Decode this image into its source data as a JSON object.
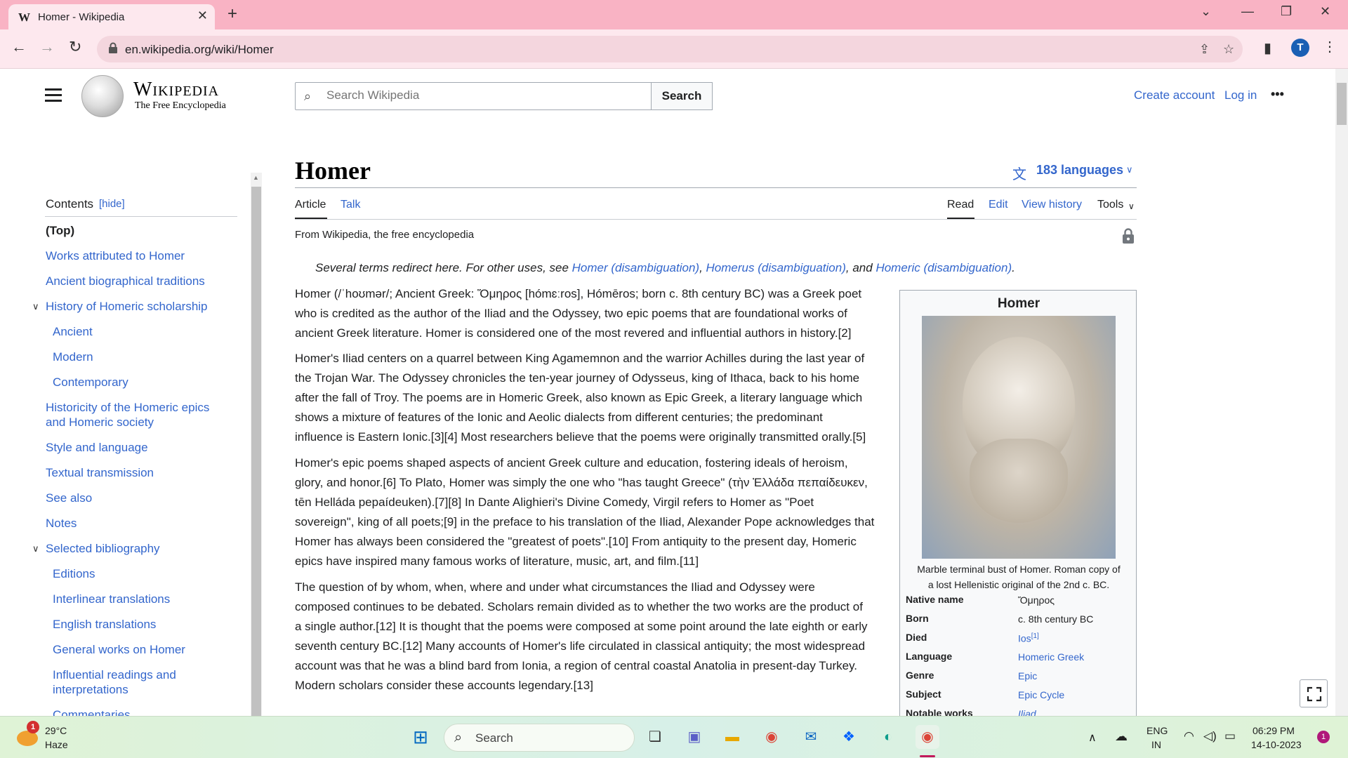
{
  "browser": {
    "tab_title": "Homer - Wikipedia",
    "favicon": "W",
    "new_tab": "+",
    "url": "en.wikipedia.org/wiki/Homer",
    "profile_initial": "T"
  },
  "wiki": {
    "wordmark": "Wikipedia",
    "tagline": "The Free Encyclopedia",
    "search_placeholder": "Search Wikipedia",
    "search_button": "Search",
    "create_account": "Create account",
    "log_in": "Log in",
    "more": "•••"
  },
  "toc": {
    "heading": "Contents",
    "hide": "[hide]",
    "items": [
      {
        "label": "(Top)"
      },
      {
        "label": "Works attributed to Homer"
      },
      {
        "label": "Ancient biographical traditions"
      },
      {
        "label": "History of Homeric scholarship"
      },
      {
        "label": "Ancient"
      },
      {
        "label": "Modern"
      },
      {
        "label": "Contemporary"
      },
      {
        "label": "Historicity of the Homeric epics"
      },
      {
        "label": "and Homeric society"
      },
      {
        "label": "Style and language"
      },
      {
        "label": "Textual transmission"
      },
      {
        "label": "See also"
      },
      {
        "label": "Notes"
      },
      {
        "label": "Selected bibliography"
      },
      {
        "label": "Editions"
      },
      {
        "label": "Interlinear translations"
      },
      {
        "label": "English translations"
      },
      {
        "label": "General works on Homer"
      },
      {
        "label": "Influential readings and"
      },
      {
        "label": "interpretations"
      },
      {
        "label": "Commentaries"
      }
    ]
  },
  "article": {
    "title": "Homer",
    "languages": "183 languages",
    "tab_article": "Article",
    "tab_talk": "Talk",
    "tab_read": "Read",
    "tab_edit": "Edit",
    "tab_history": "View history",
    "tab_tools": "Tools",
    "from": "From Wikipedia, the free encyclopedia",
    "hatnote": {
      "prefix": "Several terms redirect here. For other uses, see ",
      "l1": "Homer (disambiguation)",
      "sep1": ", ",
      "l2": "Homerus (disambiguation)",
      "sep2": ", and ",
      "l3": "Homeric (disambiguation)",
      "end": "."
    },
    "p1": [
      "Homer (/ˈhoʊmər/; Ancient Greek: Ὅμηρος [hómɛːros], Hómēros; born c. 8th century BC) was a Greek poet",
      "who is credited as the author of the Iliad and the Odyssey, two epic poems that are foundational works of",
      "ancient Greek literature. Homer is considered one of the most revered and influential authors in history.[2]"
    ],
    "p2": [
      "Homer's Iliad centers on a quarrel between King Agamemnon and the warrior Achilles during the last year of",
      "the Trojan War. The Odyssey chronicles the ten-year journey of Odysseus, king of Ithaca, back to his home",
      "after the fall of Troy. The poems are in Homeric Greek, also known as Epic Greek, a literary language which",
      "shows a mixture of features of the Ionic and Aeolic dialects from different centuries; the predominant",
      "influence is Eastern Ionic.[3][4] Most researchers believe that the poems were originally transmitted orally.[5]"
    ],
    "p3": [
      "Homer's epic poems shaped aspects of ancient Greek culture and education, fostering ideals of heroism,",
      "glory, and honor.[6] To Plato, Homer was simply the one who \"has taught Greece\" (τὴν Ἑλλάδα πεπαίδευκεν,",
      "tēn Helláda pepaídeuken).[7][8] In Dante Alighieri's Divine Comedy, Virgil refers to Homer as \"Poet",
      "sovereign\", king of all poets;[9] in the preface to his translation of the Iliad, Alexander Pope acknowledges that",
      "Homer has always been considered the \"greatest of poets\".[10] From antiquity to the present day, Homeric",
      "epics have inspired many famous works of literature, music, art, and film.[11]"
    ],
    "p4": [
      "The question of by whom, when, where and under what circumstances the Iliad and Odyssey were",
      "composed continues to be debated. Scholars remain divided as to whether the two works are the product of",
      "a single author.[12] It is thought that the poems were composed at some point around the late eighth or early",
      "seventh century BC.[12] Many accounts of Homer's life circulated in classical antiquity; the most widespread",
      "account was that he was a blind bard from Ionia, a region of central coastal Anatolia in present-day Turkey.",
      "Modern scholars consider these accounts legendary.[13]"
    ]
  },
  "infobox": {
    "title": "Homer",
    "caption_1": "Marble terminal bust of Homer. Roman copy of",
    "caption_2": "a lost Hellenistic original of the 2nd c. BC.",
    "rows": [
      {
        "label": "Native name",
        "value": "Ὅμηρος"
      },
      {
        "label": "Born",
        "value": "c. 8th century BC"
      },
      {
        "label": "Died",
        "value": "Ios",
        "ref": "[1]"
      },
      {
        "label": "Language",
        "value": "Homeric Greek"
      },
      {
        "label": "Genre",
        "value": "Epic"
      },
      {
        "label": "Subject",
        "value": "Epic Cycle"
      },
      {
        "label": "Notable works",
        "value": "Iliad"
      }
    ]
  },
  "taskbar": {
    "weather_badge": "1",
    "temperature": "29°C",
    "weather": "Haze",
    "search_label": "Search",
    "lang_1": "ENG",
    "lang_2": "IN",
    "time": "06:29 PM",
    "date": "14-10-2023",
    "notif": "1"
  }
}
